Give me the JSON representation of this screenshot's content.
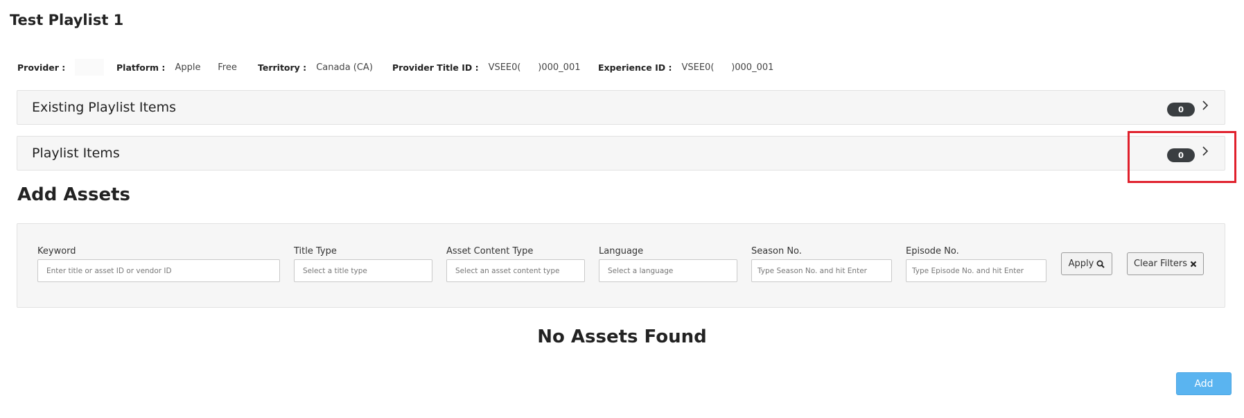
{
  "page": {
    "title": "Test Playlist 1"
  },
  "meta": {
    "provider": {
      "label": "Provider :",
      "value": ""
    },
    "platform": {
      "label": "Platform :",
      "value": "Apple      Free"
    },
    "territory": {
      "label": "Territory :",
      "value": "Canada (CA)"
    },
    "provider_title_id": {
      "label": "Provider Title ID :",
      "value": "VSEE0(      )000_001"
    },
    "experience_id": {
      "label": "Experience ID :",
      "value": "VSEE0(      )000_001"
    }
  },
  "accordions": {
    "existing": {
      "title": "Existing Playlist Items",
      "count": "0"
    },
    "items": {
      "title": "Playlist Items",
      "count": "0"
    }
  },
  "add_assets": {
    "heading": "Add Assets",
    "filters": {
      "keyword": {
        "label": "Keyword",
        "placeholder": "Enter title or asset ID or vendor ID"
      },
      "title_type": {
        "label": "Title Type",
        "placeholder": "Select a title type"
      },
      "asset_content_type": {
        "label": "Asset Content Type",
        "placeholder": "Select an asset content type"
      },
      "language": {
        "label": "Language",
        "placeholder": "Select a language"
      },
      "season_no": {
        "label": "Season No.",
        "placeholder": "Type Season No. and hit Enter"
      },
      "episode_no": {
        "label": "Episode No.",
        "placeholder": "Type Episode No. and hit Enter"
      }
    },
    "apply_label": "Apply",
    "clear_label": "Clear Filters",
    "empty_message": "No Assets Found",
    "add_label": "Add"
  },
  "icons": {
    "search": "search-icon",
    "clear": "times-icon",
    "chevron": "chevron-right-icon"
  },
  "colors": {
    "badge_bg": "#3a3e41",
    "highlight": "#e0202c",
    "add_button": "#5ab4f0",
    "panel_bg": "#f6f6f6"
  }
}
